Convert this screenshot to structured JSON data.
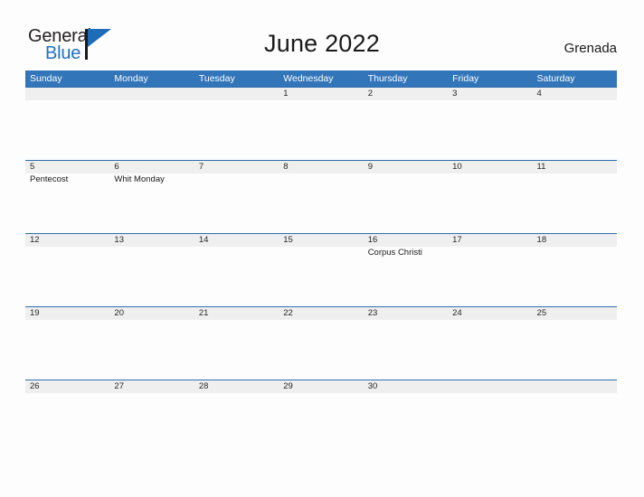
{
  "brand": {
    "name_part1": "General",
    "name_part2": "Blue",
    "triangle_color": "#1c6cb8",
    "text_color": "#231f20",
    "blue_color": "#1f6fc4"
  },
  "header": {
    "title": "June 2022",
    "country": "Grenada"
  },
  "theme": {
    "header_bg": "#3275b9",
    "header_text": "#ffffff",
    "date_band_bg": "#efefef",
    "week_rule": "#2f6fae",
    "page_bg": "#fdfdfd",
    "body_text": "#1a1a1a"
  },
  "calendar": {
    "weekdays": [
      "Sunday",
      "Monday",
      "Tuesday",
      "Wednesday",
      "Thursday",
      "Friday",
      "Saturday"
    ],
    "weeks": [
      [
        {
          "date": "",
          "events": []
        },
        {
          "date": "",
          "events": []
        },
        {
          "date": "",
          "events": []
        },
        {
          "date": "1",
          "events": []
        },
        {
          "date": "2",
          "events": []
        },
        {
          "date": "3",
          "events": []
        },
        {
          "date": "4",
          "events": []
        }
      ],
      [
        {
          "date": "5",
          "events": [
            "Pentecost"
          ]
        },
        {
          "date": "6",
          "events": [
            "Whit Monday"
          ]
        },
        {
          "date": "7",
          "events": []
        },
        {
          "date": "8",
          "events": []
        },
        {
          "date": "9",
          "events": []
        },
        {
          "date": "10",
          "events": []
        },
        {
          "date": "11",
          "events": []
        }
      ],
      [
        {
          "date": "12",
          "events": []
        },
        {
          "date": "13",
          "events": []
        },
        {
          "date": "14",
          "events": []
        },
        {
          "date": "15",
          "events": []
        },
        {
          "date": "16",
          "events": [
            "Corpus Christi"
          ]
        },
        {
          "date": "17",
          "events": []
        },
        {
          "date": "18",
          "events": []
        }
      ],
      [
        {
          "date": "19",
          "events": []
        },
        {
          "date": "20",
          "events": []
        },
        {
          "date": "21",
          "events": []
        },
        {
          "date": "22",
          "events": []
        },
        {
          "date": "23",
          "events": []
        },
        {
          "date": "24",
          "events": []
        },
        {
          "date": "25",
          "events": []
        }
      ],
      [
        {
          "date": "26",
          "events": []
        },
        {
          "date": "27",
          "events": []
        },
        {
          "date": "28",
          "events": []
        },
        {
          "date": "29",
          "events": []
        },
        {
          "date": "30",
          "events": []
        },
        {
          "date": "",
          "events": []
        },
        {
          "date": "",
          "events": []
        }
      ]
    ]
  }
}
